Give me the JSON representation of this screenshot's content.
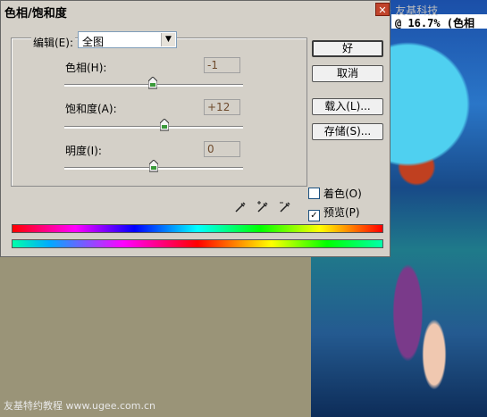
{
  "canvas": {
    "title": "@ 16.7% (色相",
    "watermark_top": "© 邓永昭 (东 朝) · 友基科技",
    "watermark_bottom": "友基特约教程 www.ugee.com.cn"
  },
  "dialog": {
    "title": "色相/饱和度",
    "close_glyph": "✕",
    "edit": {
      "label": "编辑(E):",
      "selected": "全图",
      "arrow_glyph": "▼"
    },
    "fields": [
      {
        "label": "色相(H):",
        "value": "-1",
        "level": -1,
        "min": -180,
        "max": 180
      },
      {
        "label": "饱和度(A):",
        "value": "+12",
        "level": 12,
        "min": -100,
        "max": 100
      },
      {
        "label": "明度(I):",
        "value": "0",
        "level": 0,
        "min": -100,
        "max": 100
      }
    ],
    "buttons": {
      "ok": "好",
      "cancel": "取消",
      "load": "载入(L)...",
      "save": "存储(S)..."
    },
    "checkboxes": {
      "colorize": {
        "label": "着色(O)",
        "checked": false
      },
      "preview": {
        "label": "预览(P)",
        "checked": true,
        "check_glyph": "✓"
      }
    },
    "eyedroppers": [
      "eyedropper-icon",
      "eyedropper-plus-icon",
      "eyedropper-minus-icon"
    ]
  }
}
